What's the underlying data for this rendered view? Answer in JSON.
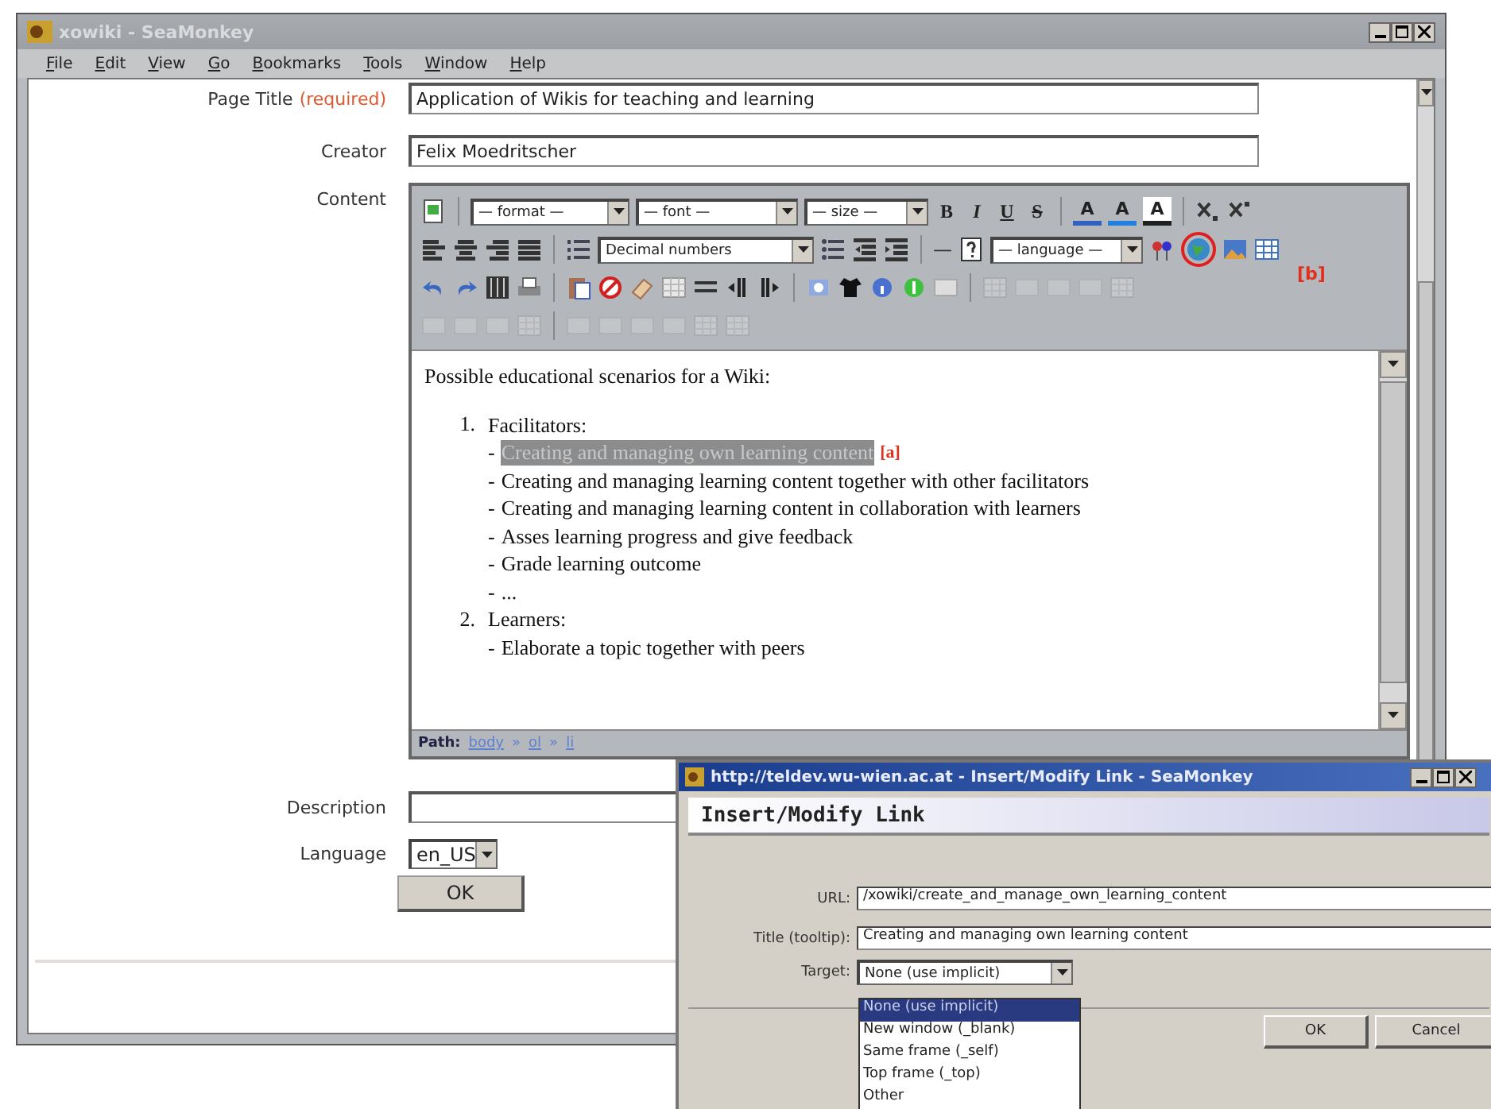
{
  "window": {
    "title": "xowiki - SeaMonkey"
  },
  "menu": [
    {
      "label": "File"
    },
    {
      "label": "Edit"
    },
    {
      "label": "View"
    },
    {
      "label": "Go"
    },
    {
      "label": "Bookmarks"
    },
    {
      "label": "Tools"
    },
    {
      "label": "Window"
    },
    {
      "label": "Help"
    }
  ],
  "form": {
    "page_title": {
      "label": "Page Title",
      "required_note": "(required)",
      "value": "Application of Wikis for teaching and learning"
    },
    "creator": {
      "label": "Creator",
      "value": "Felix Moedritscher"
    },
    "content": {
      "label": "Content"
    },
    "description": {
      "label": "Description"
    },
    "language": {
      "label": "Language",
      "value": "en_US"
    },
    "submit": "OK"
  },
  "editor": {
    "format_select": "— format —",
    "font_select": "— font —",
    "size_select": "— size —",
    "style_buttons": [
      "B",
      "I",
      "U",
      "S"
    ],
    "color_buttons": [
      {
        "label": "A",
        "color": "#3060c0"
      },
      {
        "label": "A",
        "color": "#2080e0"
      },
      {
        "label": "A",
        "color": "#202020"
      }
    ],
    "list_select": "Decimal numbers",
    "language_select": "— language —",
    "hr_button": "—",
    "toolbar_annotation": "[b]",
    "document": {
      "intro": "Possible educational scenarios for a Wiki:",
      "list": [
        {
          "number": "1.",
          "title": "Facilitators:",
          "lines": [
            {
              "bullet": "-",
              "text": "Creating and managing own learning content",
              "selected": true,
              "annotation": "[a]"
            },
            {
              "bullet": "-",
              "text": "Creating and managing learning content together with other facilitators",
              "selected": false
            },
            {
              "bullet": "-",
              "text": "Creating and managing learning content in collaboration with learners",
              "selected": false
            },
            {
              "bullet": "-",
              "text": "Asses learning progress and give feedback",
              "selected": false
            },
            {
              "bullet": "-",
              "text": "Grade learning outcome",
              "selected": false
            },
            {
              "bullet": "-",
              "text": "...",
              "selected": false
            }
          ]
        },
        {
          "number": "2.",
          "title": "Learners:",
          "lines": [
            {
              "bullet": "-",
              "text": "Elaborate a topic together with peers",
              "selected": false
            }
          ]
        }
      ]
    },
    "path": {
      "label": "Path:",
      "separator": "»",
      "items": [
        "body",
        "ol",
        "li"
      ]
    }
  },
  "dialog": {
    "title": "http://teldev.wu-wien.ac.at - Insert/Modify Link - SeaMonkey",
    "heading": "Insert/Modify Link",
    "fields": [
      {
        "label": "URL:",
        "value": "/xowiki/create_and_manage_own_learning_content"
      },
      {
        "label": "Title (tooltip):",
        "value": "Creating and managing own learning content"
      }
    ],
    "target": {
      "label": "Target:",
      "value": "None (use implicit)",
      "options": [
        {
          "label": "None (use implicit)",
          "selected": true
        },
        {
          "label": "New window (_blank)",
          "selected": false
        },
        {
          "label": "Same frame (_self)",
          "selected": false
        },
        {
          "label": "Top frame (_top)",
          "selected": false
        },
        {
          "label": "Other",
          "selected": false
        }
      ]
    },
    "buttons": [
      "OK",
      "Cancel"
    ]
  }
}
